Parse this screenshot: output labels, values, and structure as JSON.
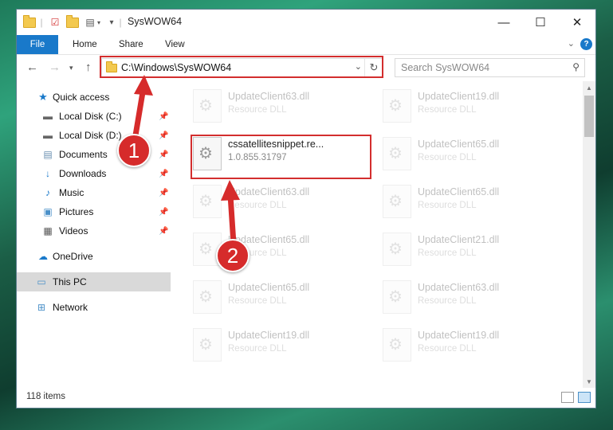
{
  "window": {
    "title": "SysWOW64",
    "controls": {
      "minimize": "—",
      "maximize": "☐",
      "close": "✕"
    }
  },
  "ribbon": {
    "tabs": [
      "File",
      "Home",
      "Share",
      "View"
    ],
    "help": "?"
  },
  "navbar": {
    "address": "C:\\Windows\\SysWOW64",
    "search_placeholder": "Search SysWOW64"
  },
  "sidebar": {
    "items": [
      {
        "label": "Quick access",
        "icon": "star-icon"
      },
      {
        "label": "Local Disk (C:)",
        "icon": "drive-icon",
        "pinned": true
      },
      {
        "label": "Local Disk (D:)",
        "icon": "drive-icon",
        "pinned": true
      },
      {
        "label": "Documents",
        "icon": "documents-icon",
        "pinned": true
      },
      {
        "label": "Downloads",
        "icon": "downloads-icon",
        "pinned": true
      },
      {
        "label": "Music",
        "icon": "music-icon",
        "pinned": true
      },
      {
        "label": "Pictures",
        "icon": "pictures-icon",
        "pinned": true
      },
      {
        "label": "Videos",
        "icon": "videos-icon",
        "pinned": true
      },
      {
        "label": "OneDrive",
        "icon": "cloud-icon"
      },
      {
        "label": "This PC",
        "icon": "computer-icon",
        "selected": true
      },
      {
        "label": "Network",
        "icon": "network-icon"
      }
    ]
  },
  "files": {
    "left": [
      {
        "name": "UpdateClient63.dll",
        "type": "Resource DLL"
      },
      {
        "name": "cssatellitesnippet.re...",
        "type": "1.0.855.31797"
      },
      {
        "name": "UpdateClient63.dll",
        "type": "Resource DLL"
      },
      {
        "name": "UpdateClient65.dll",
        "type": "Resource DLL"
      },
      {
        "name": "UpdateClient65.dll",
        "type": "Resource DLL"
      },
      {
        "name": "UpdateClient19.dll",
        "type": "Resource DLL"
      }
    ],
    "right": [
      {
        "name": "UpdateClient19.dll",
        "type": "Resource DLL"
      },
      {
        "name": "UpdateClient65.dll",
        "type": "Resource DLL"
      },
      {
        "name": "UpdateClient65.dll",
        "type": "Resource DLL"
      },
      {
        "name": "UpdateClient21.dll",
        "type": "Resource DLL"
      },
      {
        "name": "UpdateClient63.dll",
        "type": "Resource DLL"
      },
      {
        "name": "UpdateClient19.dll",
        "type": "Resource DLL"
      }
    ]
  },
  "status": {
    "item_count": "118 items"
  },
  "annotations": {
    "badge1": "1",
    "badge2": "2"
  },
  "colors": {
    "accent": "#1979ca",
    "annotation": "#d62b2b"
  }
}
